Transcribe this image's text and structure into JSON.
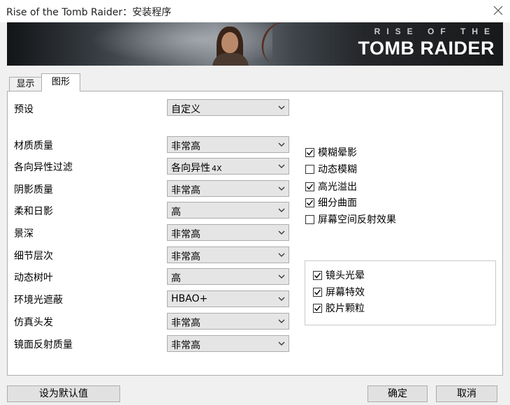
{
  "window": {
    "title": "Rise of the Tomb Raider：安装程序"
  },
  "banner": {
    "line1": "RISE OF THE",
    "line2": "TOMB RAIDER"
  },
  "tabs": [
    {
      "label": "显示"
    },
    {
      "label": "图形",
      "active": true
    }
  ],
  "preset": {
    "label": "预设",
    "value": "自定义"
  },
  "settings": [
    {
      "label": "材质质量",
      "value": "非常高"
    },
    {
      "label": "各向异性过滤",
      "value": "各向异性",
      "suffix": "4X"
    },
    {
      "label": "阴影质量",
      "value": "非常高"
    },
    {
      "label": "柔和日影",
      "value": "高"
    },
    {
      "label": "景深",
      "value": "非常高"
    },
    {
      "label": "细节层次",
      "value": "非常高"
    },
    {
      "label": "动态树叶",
      "value": "高"
    },
    {
      "label": "环境光遮蔽",
      "value": "HBAO+"
    },
    {
      "label": "仿真头发",
      "value": "非常高"
    },
    {
      "label": "镜面反射质量",
      "value": "非常高"
    }
  ],
  "checkboxes": [
    {
      "label": "模糊晕影",
      "checked": true
    },
    {
      "label": "动态模糊",
      "checked": false
    },
    {
      "label": "高光溢出",
      "checked": true
    },
    {
      "label": "细分曲面",
      "checked": true
    },
    {
      "label": "屏幕空间反射效果",
      "checked": false
    }
  ],
  "group_checkboxes": [
    {
      "label": "镜头光晕",
      "checked": true
    },
    {
      "label": "屏幕特效",
      "checked": true
    },
    {
      "label": "胶片颗粒",
      "checked": true
    }
  ],
  "buttons": {
    "default": "设为默认值",
    "ok": "确定",
    "cancel": "取消"
  }
}
